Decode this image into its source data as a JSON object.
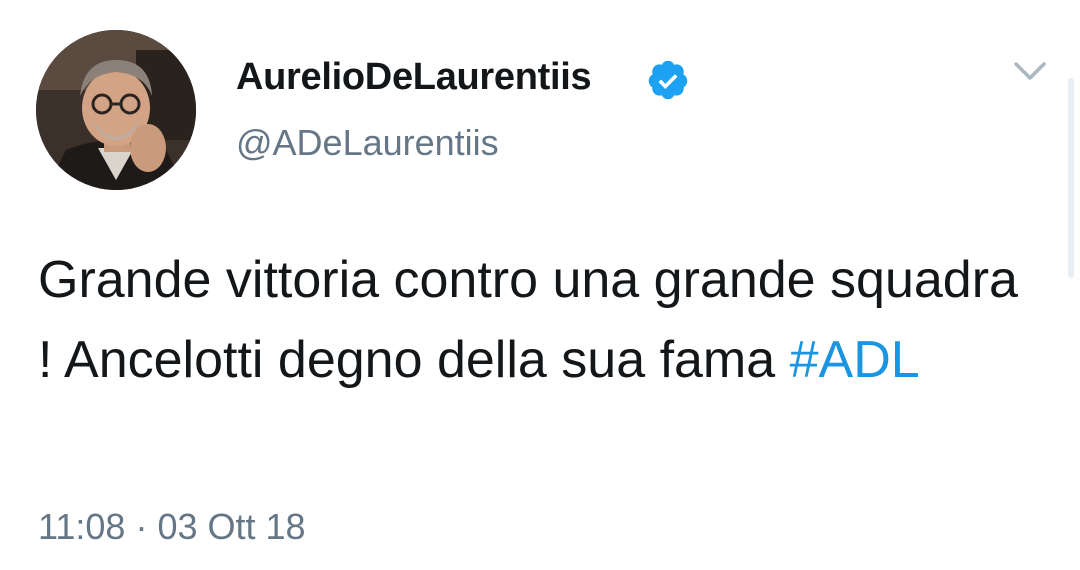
{
  "user": {
    "display_name": "AurelioDeLaurentiis",
    "handle": "@ADeLaurentiis",
    "verified": true,
    "avatar_icon": "profile-photo"
  },
  "tweet": {
    "text": "Grande vittoria contro una grande squadra ! Ancelotti degno della sua fama ",
    "hashtag": "#ADL",
    "time": "11:08",
    "separator": "·",
    "date": "03 Ott 18"
  },
  "icons": {
    "verified_badge": "verified-badge-icon",
    "more_menu": "chevron-down-icon"
  },
  "colors": {
    "text": "#14171a",
    "secondary": "#657786",
    "link": "#1b95e0",
    "verified": "#1da1f2"
  }
}
